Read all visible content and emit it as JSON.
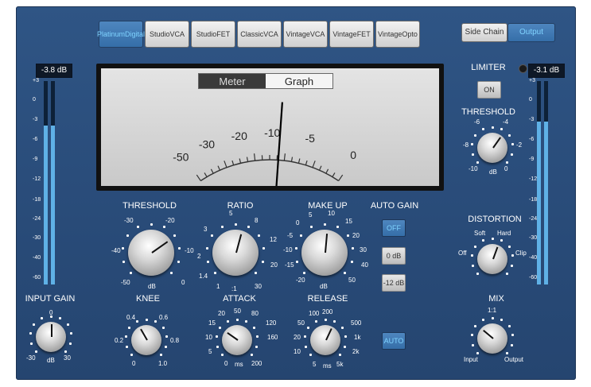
{
  "modes": [
    {
      "line1": "Platinum",
      "line2": "Digital",
      "active": true
    },
    {
      "line1": "Studio",
      "line2": "VCA",
      "active": false
    },
    {
      "line1": "Studio",
      "line2": "FET",
      "active": false
    },
    {
      "line1": "Classic",
      "line2": "VCA",
      "active": false
    },
    {
      "line1": "Vintage",
      "line2": "VCA",
      "active": false
    },
    {
      "line1": "Vintage",
      "line2": "FET",
      "active": false
    },
    {
      "line1": "Vintage",
      "line2": "Opto",
      "active": false
    }
  ],
  "side_chain_label": "Side Chain",
  "output_label": "Output",
  "meter_tabs": {
    "meter": "Meter",
    "graph": "Graph"
  },
  "vu_scale": [
    "-50",
    "-30",
    "-20",
    "-10",
    "-5",
    "0"
  ],
  "input_readout": "-3.8 dB",
  "output_readout": "-3.1 dB",
  "meter_scale": [
    "+3",
    "0",
    "-3",
    "-6",
    "-9",
    "-12",
    "-18",
    "-24",
    "-30",
    "-40",
    "-60"
  ],
  "input_meter_level": 0.78,
  "output_meter_level": 0.8,
  "limiter": {
    "label": "LIMITER",
    "on_label": "ON"
  },
  "limiter_threshold": {
    "label": "THRESHOLD",
    "ticks": [
      "-6",
      "-4",
      "-8",
      "-2",
      "-10",
      "dB",
      "0"
    ]
  },
  "threshold": {
    "label": "THRESHOLD",
    "ticks": [
      "-30",
      "-20",
      "-40",
      "-10",
      "-50",
      "dB",
      "0"
    ]
  },
  "ratio": {
    "label": "RATIO",
    "ticks": [
      "5",
      "8",
      "3",
      "12",
      "2",
      "20",
      "1.4",
      "1",
      ":1",
      "30"
    ]
  },
  "makeup": {
    "label": "MAKE UP",
    "ticks": [
      "5",
      "10",
      "0",
      "15",
      "-5",
      "20",
      "-10",
      "30",
      "-15",
      "40",
      "-20",
      "dB",
      "50"
    ]
  },
  "auto_gain": {
    "label": "AUTO GAIN",
    "off": "OFF",
    "zero": "0 dB",
    "minus12": "-12 dB"
  },
  "input_gain": {
    "label": "INPUT GAIN",
    "ticks": [
      "0",
      "-30",
      "dB",
      "30"
    ]
  },
  "knee": {
    "label": "KNEE",
    "ticks": [
      "0.4",
      "0.6",
      "0.2",
      "0.8",
      "0",
      "1.0"
    ]
  },
  "attack": {
    "label": "ATTACK",
    "ticks": [
      "20",
      "50",
      "80",
      "15",
      "120",
      "10",
      "160",
      "5",
      "0",
      "ms",
      "200"
    ]
  },
  "release": {
    "label": "RELEASE",
    "ticks": [
      "100",
      "200",
      "50",
      "500",
      "20",
      "1k",
      "10",
      "2k",
      "5",
      "ms",
      "5k"
    ]
  },
  "auto_label": "AUTO",
  "distortion": {
    "label": "DISTORTION",
    "ticks": [
      "Soft",
      "Hard",
      "Off",
      "Clip"
    ]
  },
  "mix": {
    "label": "MIX",
    "ticks": [
      "1:1",
      "Input",
      "Output"
    ]
  }
}
